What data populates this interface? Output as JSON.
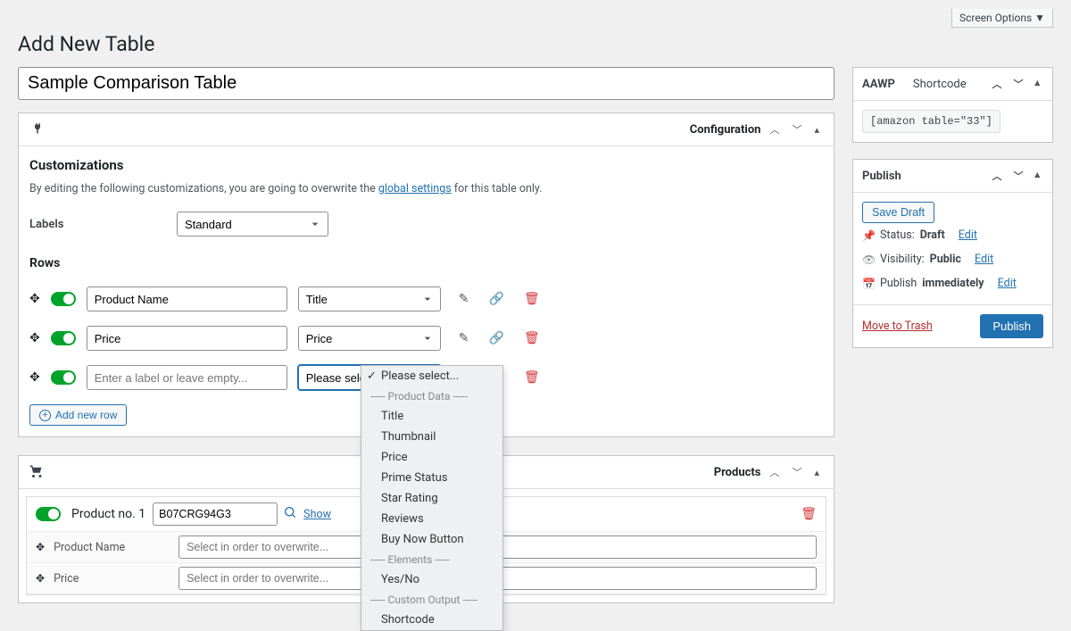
{
  "screen_options": "Screen Options ▼",
  "page_title": "Add New Table",
  "title_value": "Sample Comparison Table",
  "config_panel": {
    "title": "Configuration",
    "customizations_title": "Customizations",
    "desc_prefix": "By editing the following customizations, you are going to overwrite the ",
    "desc_link": "global settings",
    "desc_suffix": " for this table only.",
    "labels_label": "Labels",
    "labels_value": "Standard",
    "rows_title": "Rows",
    "rows": [
      {
        "label": "Product Name",
        "type": "Title"
      },
      {
        "label": "Price",
        "type": "Price"
      },
      {
        "label": "",
        "placeholder": "Enter a label or leave empty...",
        "type": "Please select..."
      }
    ],
    "add_row": "Add new row",
    "dropdown": {
      "selected": "Please select...",
      "group1": "----- Product Data -----",
      "options1": [
        "Title",
        "Thumbnail",
        "Price",
        "Prime Status",
        "Star Rating",
        "Reviews",
        "Buy Now Button"
      ],
      "group2": "----- Elements -----",
      "options2": [
        "Yes/No"
      ],
      "group3": "----- Custom Output -----",
      "options3": [
        "Shortcode"
      ]
    }
  },
  "products_panel": {
    "title": "Products",
    "product_label": "Product no. 1",
    "asin": "B07CRG94G3",
    "show": "Show",
    "fields": [
      {
        "label": "Product Name",
        "placeholder": "Select in order to overwrite..."
      },
      {
        "label": "Price",
        "placeholder": "Select in order to overwrite..."
      }
    ]
  },
  "aawp_panel": {
    "title": "AAWP",
    "tab": "Shortcode",
    "shortcode": "[amazon table=\"33\"]"
  },
  "publish_panel": {
    "title": "Publish",
    "save_draft": "Save Draft",
    "status_label": "Status: ",
    "status_value": "Draft",
    "visibility_label": "Visibility: ",
    "visibility_value": "Public",
    "publish_label": "Publish ",
    "publish_value": "immediately",
    "edit": "Edit",
    "move_trash": "Move to Trash",
    "publish_btn": "Publish"
  }
}
